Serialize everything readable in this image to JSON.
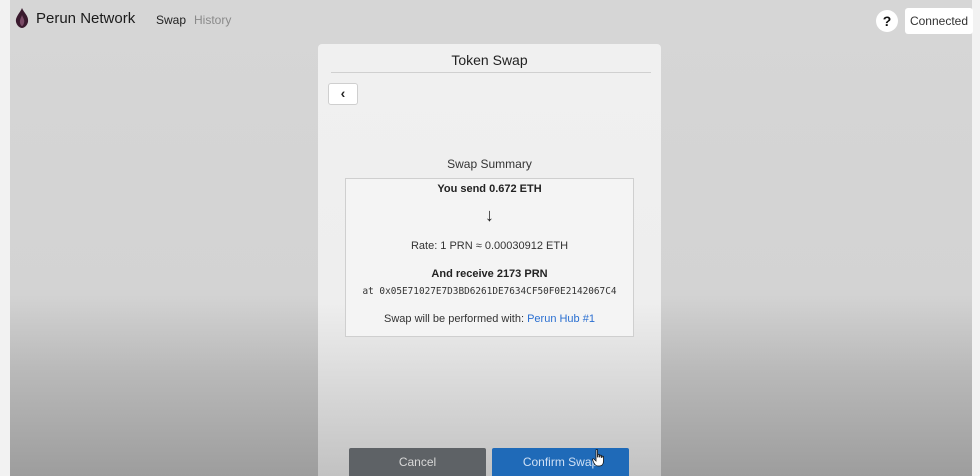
{
  "nav": {
    "brand": "Perun Network",
    "items": [
      {
        "label": "Swap",
        "active": true
      },
      {
        "label": "History",
        "active": false
      }
    ],
    "help_label": "?",
    "connected_label": "Connected"
  },
  "modal": {
    "title": "Token Swap",
    "back_label": "‹",
    "summary_heading": "Swap Summary",
    "send_text": "You send 0.672 ETH",
    "arrow": "↓",
    "rate_text": "Rate: 1 PRN ≈ 0.00030912 ETH",
    "receive_text": "And receive 2173 PRN",
    "address_text": "at 0x05E71027E7D3BD6261DE7634CF50F0E2142067C4",
    "hub_prefix": "Swap will be performed with: ",
    "hub_link": "Perun Hub #1",
    "cancel_label": "Cancel",
    "confirm_label": "Confirm Swap"
  },
  "colors": {
    "accent": "#1f6ab8",
    "link": "#2a6fd1",
    "cancel": "#5e6266",
    "logo": "#3a1a2e"
  },
  "icons": {
    "logo": "perun-flame-logo",
    "back": "chevron-left-icon",
    "cursor": "hand-pointer-icon"
  }
}
